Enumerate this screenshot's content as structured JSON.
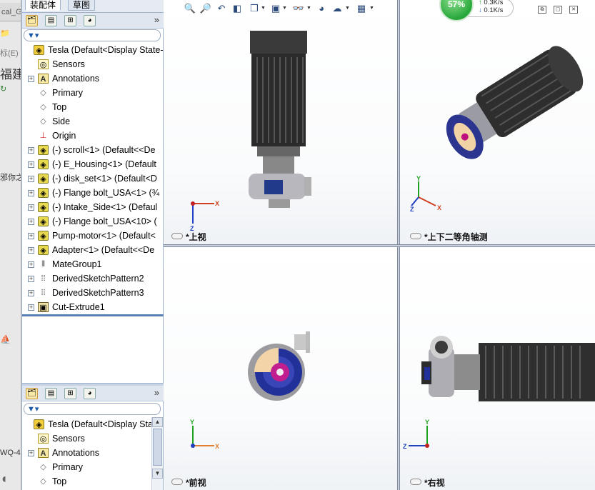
{
  "background_window": {
    "tab_text": "cal_G",
    "items": [
      "福建",
      "标(E)",
      "邪你之",
      "WQ-4"
    ]
  },
  "feature_manager": {
    "tabs": [
      "装配体",
      "草图"
    ],
    "more_label": "»",
    "tree": [
      {
        "label": "Tesla  (Default<Display State-",
        "icon": "assembly-icon",
        "expander": false,
        "indent": 0
      },
      {
        "label": "Sensors",
        "icon": "sensors-icon",
        "expander": false,
        "indent": 1
      },
      {
        "label": "Annotations",
        "icon": "annotations-icon",
        "expander": true,
        "indent": 1
      },
      {
        "label": "Primary",
        "icon": "plane-icon",
        "expander": false,
        "indent": 1
      },
      {
        "label": "Top",
        "icon": "plane-icon",
        "expander": false,
        "indent": 1
      },
      {
        "label": "Side",
        "icon": "plane-icon",
        "expander": false,
        "indent": 1
      },
      {
        "label": "Origin",
        "icon": "origin-icon",
        "expander": false,
        "indent": 1
      },
      {
        "label": "(-) scroll<1> (Default<<De",
        "icon": "part-icon",
        "expander": true,
        "indent": 1
      },
      {
        "label": "(-) E_Housing<1> (Default",
        "icon": "part-icon",
        "expander": true,
        "indent": 1
      },
      {
        "label": "(-) disk_set<1> (Default<D",
        "icon": "part-icon",
        "expander": true,
        "indent": 1
      },
      {
        "label": "(-) Flange bolt_USA<1> (¾",
        "icon": "part-icon",
        "expander": true,
        "indent": 1
      },
      {
        "label": "(-) Intake_Side<1> (Defaul",
        "icon": "part-icon",
        "expander": true,
        "indent": 1
      },
      {
        "label": "(-) Flange bolt_USA<10> (",
        "icon": "part-icon",
        "expander": true,
        "indent": 1
      },
      {
        "label": "Pump-motor<1> (Default<",
        "icon": "part-icon",
        "expander": true,
        "indent": 1
      },
      {
        "label": "Adapter<1> (Default<<De",
        "icon": "part-icon",
        "expander": true,
        "indent": 1
      },
      {
        "label": "MateGroup1",
        "icon": "mates-icon",
        "expander": true,
        "indent": 1
      },
      {
        "label": "DerivedSketchPattern2",
        "icon": "pattern-icon",
        "expander": true,
        "indent": 1
      },
      {
        "label": "DerivedSketchPattern3",
        "icon": "pattern-icon",
        "expander": true,
        "indent": 1
      },
      {
        "label": "Cut-Extrude1",
        "icon": "extrude-icon",
        "expander": true,
        "indent": 1
      }
    ],
    "tree2": [
      {
        "label": "Tesla  (Default<Display State",
        "icon": "assembly-icon",
        "expander": false,
        "indent": 0
      },
      {
        "label": "Sensors",
        "icon": "sensors-icon",
        "expander": false,
        "indent": 1
      },
      {
        "label": "Annotations",
        "icon": "annotations-icon",
        "expander": true,
        "indent": 1
      },
      {
        "label": "Primary",
        "icon": "plane-icon",
        "expander": false,
        "indent": 1
      },
      {
        "label": "Top",
        "icon": "plane-icon",
        "expander": false,
        "indent": 1
      }
    ]
  },
  "viewports": {
    "top_left": "*上视",
    "top_right": "*上下二等角轴测",
    "bottom_left": "*前视",
    "bottom_right": "*右视"
  },
  "network_widget": {
    "percent": "57%",
    "upload": "0.3K/s",
    "download": "0.1K/s"
  },
  "axes": {
    "x": "X",
    "y": "Y",
    "z": "Z"
  }
}
